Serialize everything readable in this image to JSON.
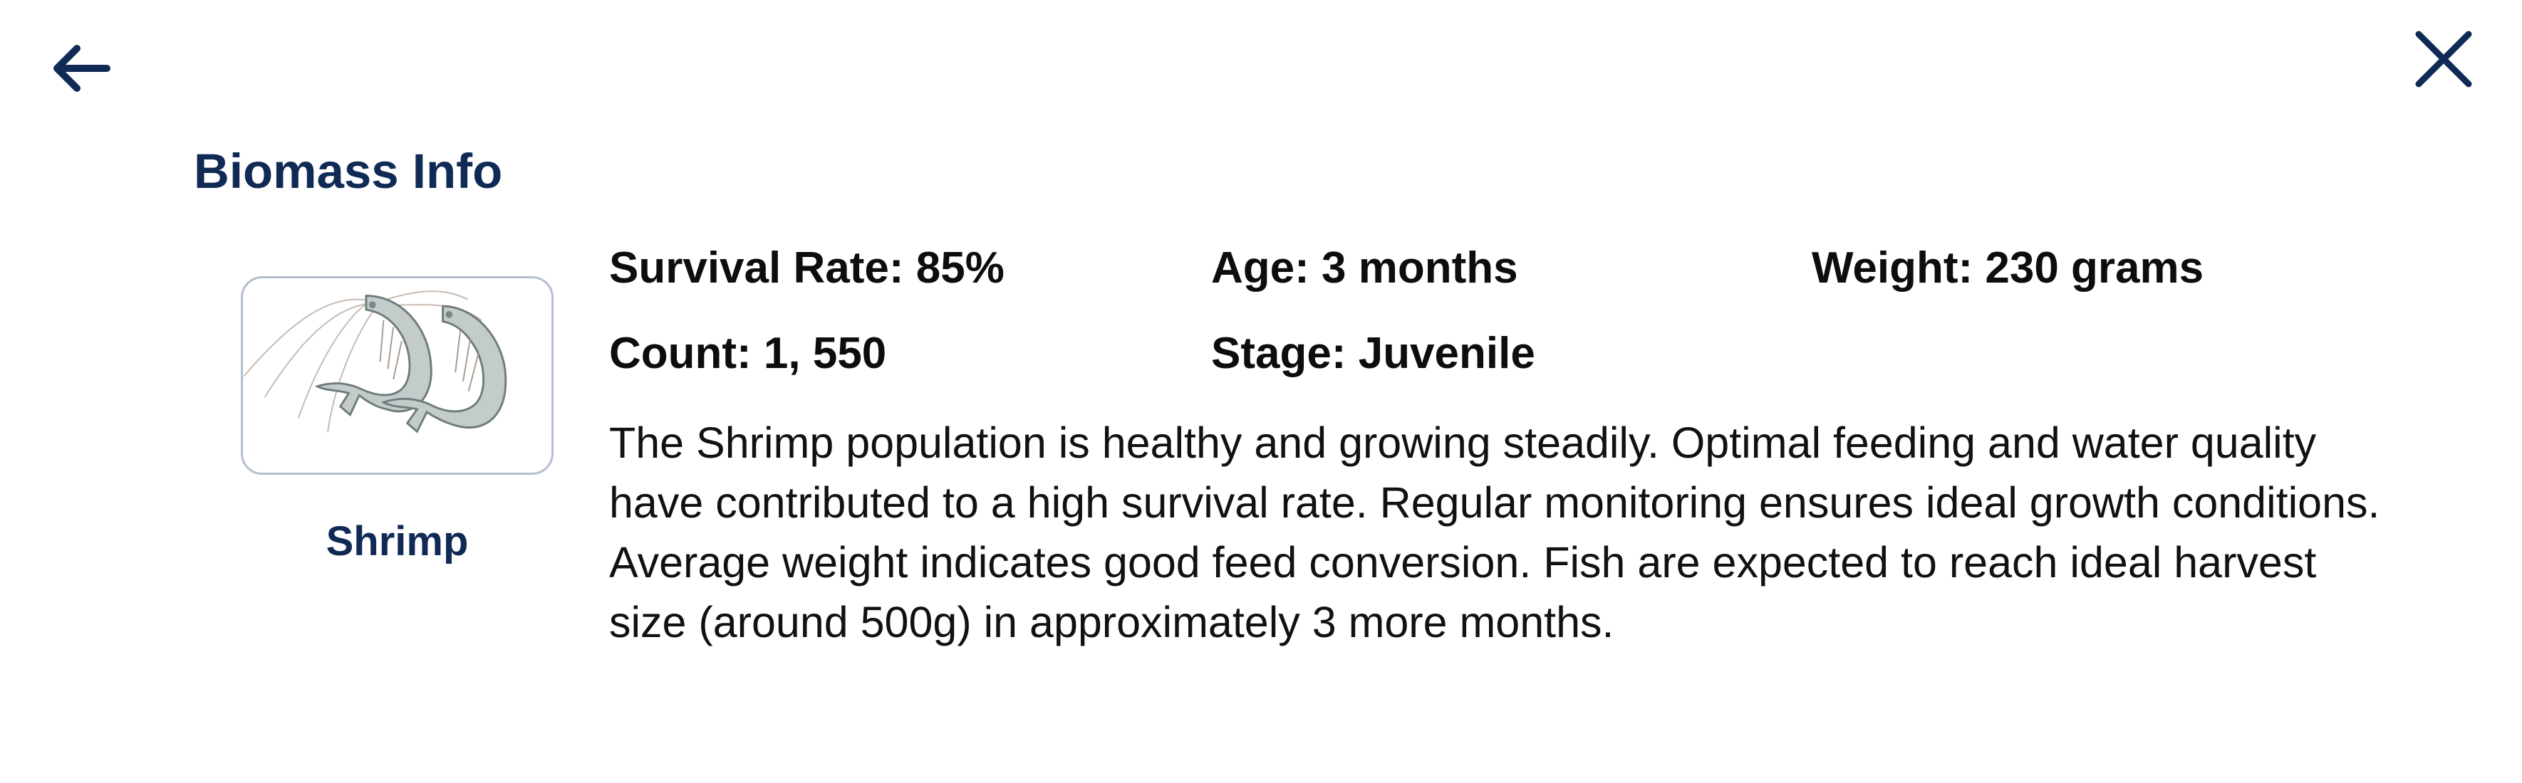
{
  "header": {
    "back_icon": "arrow-left-icon",
    "close_icon": "close-icon",
    "title": "Biomass Info"
  },
  "species": {
    "image_icon": "shrimp-image",
    "name": "Shrimp"
  },
  "stats": {
    "survival_rate": "Survival Rate: 85%",
    "age": "Age: 3 months",
    "weight": "Weight: 230 grams",
    "count": "Count: 1, 550",
    "stage": "Stage: Juvenile"
  },
  "description": "The Shrimp population is healthy and growing steadily. Optimal feeding and water quality have contributed to a high survival rate. Regular monitoring ensures ideal growth conditions. Average weight indicates good feed conversion. Fish are expected to reach ideal harvest size (around 500g) in approximately 3 more months.",
  "colors": {
    "title": "#0f2a55",
    "icon": "#0f2a55",
    "card_border": "#b3bfd0",
    "text": "#111111"
  }
}
